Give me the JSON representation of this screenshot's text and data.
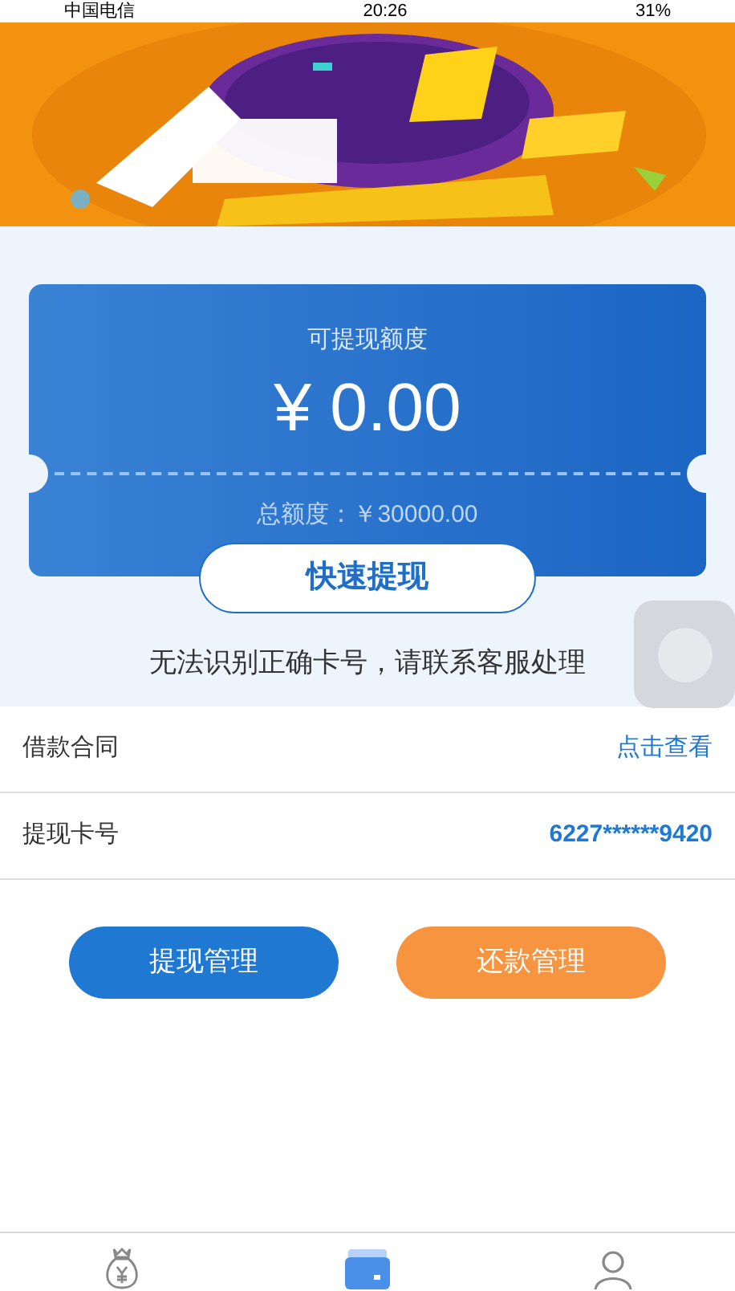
{
  "status_bar": {
    "carrier": "中国电信",
    "time": "20:26",
    "battery": "31%"
  },
  "ticket": {
    "label": "可提现额度",
    "amount": "¥ 0.00",
    "total": "总额度：￥30000.00",
    "button": "快速提现"
  },
  "message": "无法识别正确卡号，请联系客服处理",
  "rows": [
    {
      "label": "借款合同",
      "value": "点击查看",
      "kind": "link"
    },
    {
      "label": "提现卡号",
      "value": "6227******9420",
      "kind": "card"
    }
  ],
  "buttons": [
    {
      "label": "提现管理",
      "kind": "primary"
    },
    {
      "label": "还款管理",
      "kind": "secondary"
    }
  ],
  "tabs": [
    {
      "kind": "money-bag",
      "selected": false
    },
    {
      "kind": "wallet",
      "selected": true
    },
    {
      "kind": "user",
      "selected": false
    }
  ]
}
